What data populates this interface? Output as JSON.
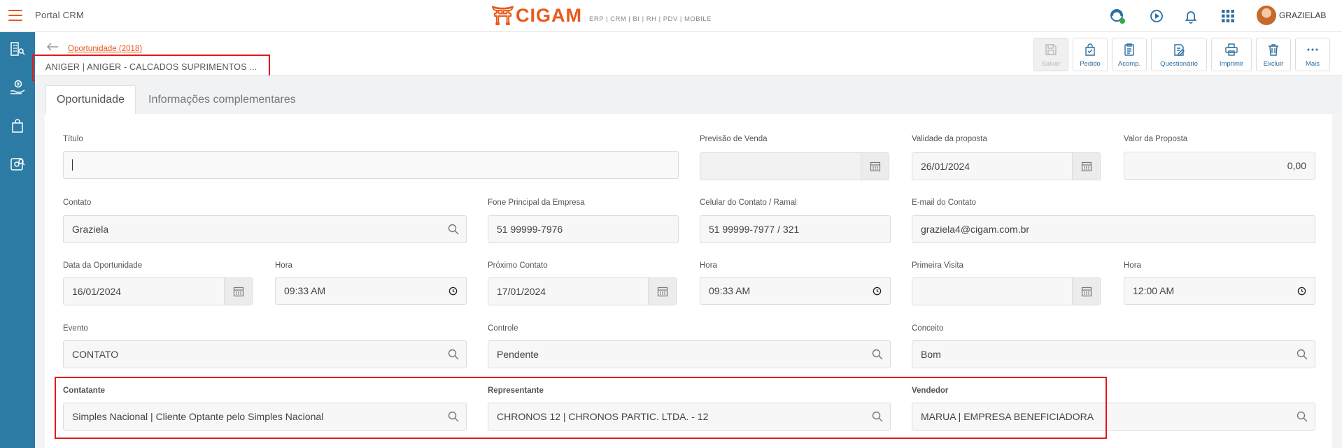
{
  "topbar": {
    "portal_title": "Portal CRM",
    "logo_mark": "⛩",
    "logo_text": "CIGAM",
    "logo_sub": "ERP | CRM | BI | RH | PDV | MOBILE",
    "username": "GRAZIELAB"
  },
  "header": {
    "breadcrumb": "Oportunidade (2018)",
    "record_title": "ANIGER | ANIGER - CALCADOS SUPRIMENTOS ..."
  },
  "toolbar": {
    "save": "Salvar",
    "order": "Pedido",
    "followup": "Acomp.",
    "questionnaire": "Questionário",
    "print": "Imprimir",
    "delete": "Excluir",
    "more": "Mais"
  },
  "tabs": {
    "opportunity": "Oportunidade",
    "complementary": "Informações complementares"
  },
  "form": {
    "titulo": {
      "label": "Título",
      "value": ""
    },
    "previsao_venda": {
      "label": "Previsão de Venda",
      "value": ""
    },
    "validade_proposta": {
      "label": "Validade da proposta",
      "value": "26/01/2024"
    },
    "valor_proposta": {
      "label": "Valor da Proposta",
      "value": "0,00"
    },
    "contato": {
      "label": "Contato",
      "value": "Graziela"
    },
    "fone_empresa": {
      "label": "Fone Principal da Empresa",
      "value": "51 99999-7976"
    },
    "celular_contato": {
      "label": "Celular do Contato / Ramal",
      "value": "51 99999-7977 / 321"
    },
    "email_contato": {
      "label": "E-mail do Contato",
      "value": "graziela4@cigam.com.br"
    },
    "data_oportunidade": {
      "label": "Data da Oportunidade",
      "value": "16/01/2024"
    },
    "hora1": {
      "label": "Hora",
      "value": "09:33  AM"
    },
    "proximo_contato": {
      "label": "Próximo Contato",
      "value": "17/01/2024"
    },
    "hora2": {
      "label": "Hora",
      "value": "09:33  AM"
    },
    "primeira_visita": {
      "label": "Primeira Visita",
      "value": ""
    },
    "hora3": {
      "label": "Hora",
      "value": "12:00  AM"
    },
    "evento": {
      "label": "Evento",
      "value": "CONTATO"
    },
    "controle": {
      "label": "Controle",
      "value": "Pendente"
    },
    "conceito": {
      "label": "Conceito",
      "value": "Bom"
    },
    "contatante": {
      "label": "Contatante",
      "value": "Simples Nacional | Cliente Optante pelo Simples Nacional"
    },
    "representante": {
      "label": "Representante",
      "value": "CHRONOS 12 | CHRONOS PARTIC. LTDA. - 12"
    },
    "vendedor": {
      "label": "Vendedor",
      "value": "MARUA | EMPRESA BENEFICIADORA"
    }
  },
  "colors": {
    "accent": "#e8591a",
    "sidebar": "#2b7ba4",
    "highlight": "#e0191e"
  }
}
